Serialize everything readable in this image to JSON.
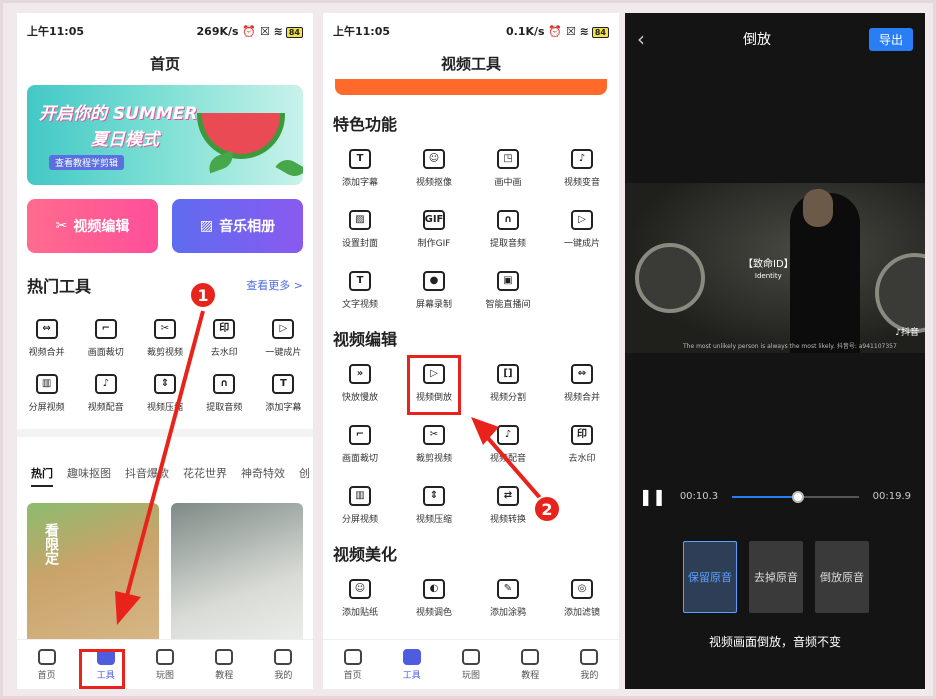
{
  "panel1": {
    "status": {
      "time": "上午11:05",
      "net": "269K/s",
      "battery": "84"
    },
    "title": "首页",
    "banner": {
      "line1": "开启你的 SUMMER",
      "line2": "夏日模式",
      "tag": "查看教程学剪辑"
    },
    "big_buttons": [
      {
        "label": "视频编辑"
      },
      {
        "label": "音乐相册"
      }
    ],
    "hot_tools": {
      "title": "热门工具",
      "more": "查看更多 >"
    },
    "tools": [
      {
        "label": "视频合并",
        "icon": "⇔"
      },
      {
        "label": "画面裁切",
        "icon": "⌐"
      },
      {
        "label": "裁剪视频",
        "icon": "✂"
      },
      {
        "label": "去水印",
        "icon": "印"
      },
      {
        "label": "一键成片",
        "icon": "▷"
      },
      {
        "label": "分屏视频",
        "icon": "▥"
      },
      {
        "label": "视频配音",
        "icon": "♪"
      },
      {
        "label": "视频压缩",
        "icon": "⇕"
      },
      {
        "label": "提取音频",
        "icon": "∩"
      },
      {
        "label": "添加字幕",
        "icon": "T"
      }
    ],
    "tabs": [
      "热门",
      "趣味抠图",
      "抖音爆款",
      "花花世界",
      "神奇特效",
      "创"
    ],
    "card1_text": "看限定",
    "nav": [
      "首页",
      "工具",
      "玩图",
      "教程",
      "我的"
    ],
    "badge": "1"
  },
  "panel2": {
    "status": {
      "time": "上午11:05",
      "net": "0.1K/s",
      "battery": "84"
    },
    "title": "视频工具",
    "sections": [
      {
        "title": "特色功能",
        "items": [
          {
            "label": "添加字幕",
            "icon": "T"
          },
          {
            "label": "视频抠像",
            "icon": "☺"
          },
          {
            "label": "画中画",
            "icon": "◳"
          },
          {
            "label": "视频变音",
            "icon": "♪"
          },
          {
            "label": "设置封面",
            "icon": "▨"
          },
          {
            "label": "制作GIF",
            "icon": "GIF"
          },
          {
            "label": "提取音频",
            "icon": "∩"
          },
          {
            "label": "一键成片",
            "icon": "▷"
          },
          {
            "label": "文字视频",
            "icon": "T"
          },
          {
            "label": "屏幕录制",
            "icon": "●"
          },
          {
            "label": "智能直播间",
            "icon": "▣"
          }
        ]
      },
      {
        "title": "视频编辑",
        "items": [
          {
            "label": "快放慢放",
            "icon": "»"
          },
          {
            "label": "视频倒放",
            "icon": "▷"
          },
          {
            "label": "视频分割",
            "icon": "[]"
          },
          {
            "label": "视频合并",
            "icon": "⇔"
          },
          {
            "label": "画面裁切",
            "icon": "⌐"
          },
          {
            "label": "裁剪视频",
            "icon": "✂"
          },
          {
            "label": "视频配音",
            "icon": "♪"
          },
          {
            "label": "去水印",
            "icon": "印"
          },
          {
            "label": "分屏视频",
            "icon": "▥"
          },
          {
            "label": "视频压缩",
            "icon": "⇕"
          },
          {
            "label": "视频转换",
            "icon": "⇄"
          }
        ]
      },
      {
        "title": "视频美化",
        "items": [
          {
            "label": "添加贴纸",
            "icon": "☺"
          },
          {
            "label": "视频调色",
            "icon": "◐"
          },
          {
            "label": "添加涂鸦",
            "icon": "✎"
          },
          {
            "label": "添加滤镜",
            "icon": "◎"
          }
        ]
      }
    ],
    "nav": [
      "首页",
      "工具",
      "玩图",
      "教程",
      "我的"
    ],
    "badge": "2"
  },
  "panel3": {
    "title": "倒放",
    "export": "导出",
    "video_label": "【致命ID】",
    "video_sub": "Identity",
    "subtitle": "The most unlikely person is always the most likely.",
    "douyin": "抖音",
    "douyin_id": "抖音号: a941107357",
    "time_current": "00:10.3",
    "time_total": "00:19.9",
    "progress": 0.52,
    "options": [
      "保留原音",
      "去掉原音",
      "倒放原音"
    ],
    "selected_option": 0,
    "description": "视频画面倒放，音频不变"
  },
  "colors": {
    "accent": "#4f5ce0",
    "highlight": "#e8231b",
    "export": "#2a7ef5"
  }
}
